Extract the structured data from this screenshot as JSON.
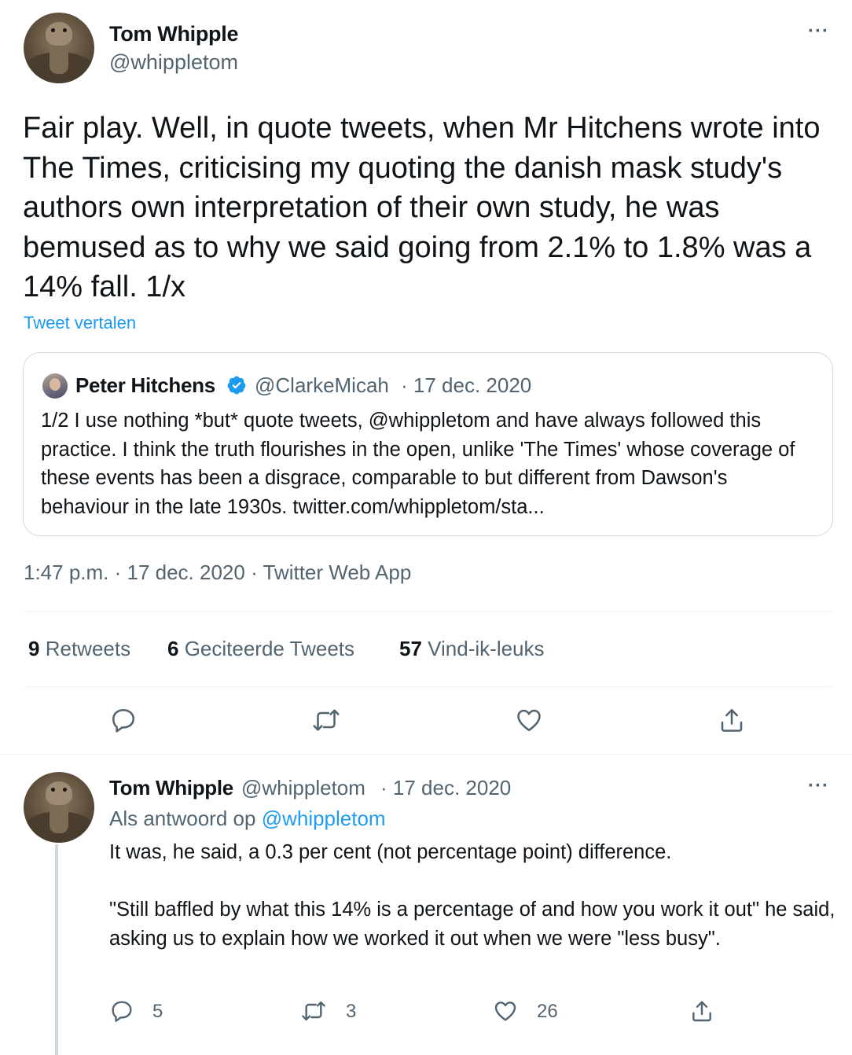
{
  "main_tweet": {
    "author_name": "Tom Whipple",
    "author_handle": "@whippletom",
    "more": "···",
    "text": "Fair play. Well, in quote tweets, when Mr Hitchens wrote into The Times, criticising my quoting the danish mask study's authors own interpretation of their own study, he was bemused as to why we said going from 2.1% to 1.8% was a 14% fall. 1/x",
    "translate_label": "Tweet vertalen",
    "quote": {
      "author_name": "Peter Hitchens",
      "author_handle": "@ClarkeMicah",
      "date": "· 17 dec. 2020",
      "text": "1/2 I use nothing *but* quote tweets, @whippletom and have always followed this practice. I think the truth flourishes in the open, unlike 'The Times' whose coverage of these events has been a disgrace, comparable to but different from Dawson's behaviour in the late 1930s. twitter.com/whippletom/sta..."
    },
    "timestamp_line": "1:47 p.m. · 17 dec. 2020 · Twitter Web App",
    "stats": {
      "retweets_count": "9",
      "retweets_label": "Retweets",
      "quotes_count": "6",
      "quotes_label": "Geciteerde Tweets",
      "likes_count": "57",
      "likes_label": "Vind-ik-leuks"
    },
    "actions": [
      "reply-icon",
      "retweet-icon",
      "like-icon",
      "share-icon"
    ]
  },
  "reply_tweet": {
    "author_name": "Tom Whipple",
    "author_handle": "@whippletom",
    "date": "· 17 dec. 2020",
    "more": "···",
    "reply_to_label": "Als antwoord op",
    "reply_to_handle": "@whippletom",
    "text": "It was, he said, a 0.3 per cent (not percentage point) difference.\n\n\"Still baffled by what this 14% is a percentage of and how you work it out\" he said, asking us to explain how we worked it out when we were \"less busy\".",
    "reply_count": "5",
    "retweet_count": "3",
    "like_count": "26"
  },
  "colors": {
    "text_primary": "#0f1419",
    "text_secondary": "#536471",
    "link": "#1d9bf0",
    "border": "#cfd9de"
  }
}
